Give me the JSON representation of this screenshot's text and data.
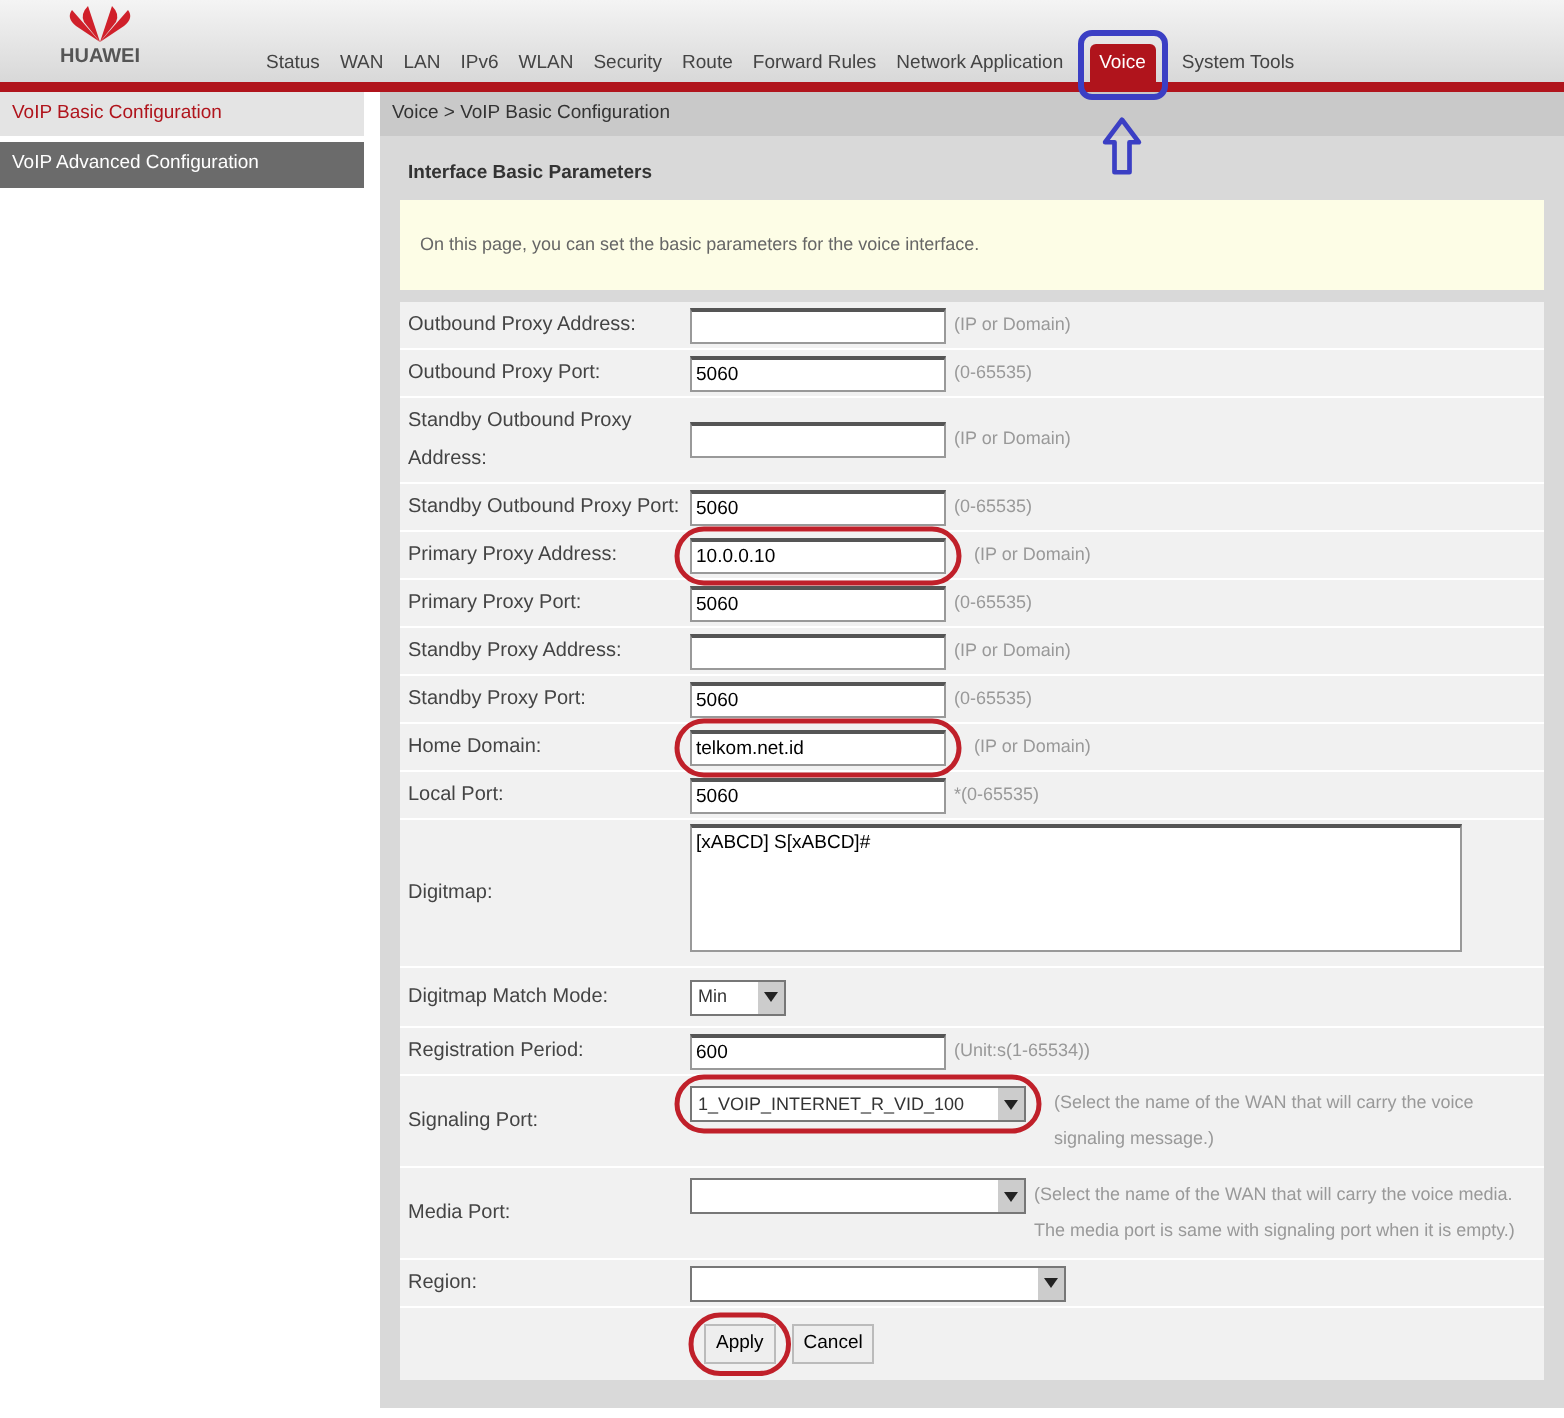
{
  "header": {
    "logo": "HUAWEI",
    "tabs": [
      {
        "label": "Status",
        "selected": false,
        "marked": false
      },
      {
        "label": "WAN",
        "selected": false,
        "marked": false
      },
      {
        "label": "LAN",
        "selected": false,
        "marked": false
      },
      {
        "label": "IPv6",
        "selected": false,
        "marked": false
      },
      {
        "label": "WLAN",
        "selected": false,
        "marked": false
      },
      {
        "label": "Security",
        "selected": false,
        "marked": false
      },
      {
        "label": "Route",
        "selected": false,
        "marked": false
      },
      {
        "label": "Forward Rules",
        "selected": false,
        "marked": false
      },
      {
        "label": "Network Application",
        "selected": false,
        "marked": false
      },
      {
        "label": "Voice",
        "selected": true,
        "marked": true
      },
      {
        "label": "System Tools",
        "selected": false,
        "marked": false
      }
    ]
  },
  "sidebar": {
    "items": [
      {
        "label": "VoIP Basic Configuration",
        "selected": true
      },
      {
        "label": "VoIP Advanced Configuration",
        "selected": false
      }
    ]
  },
  "breadcrumb": "Voice > VoIP Basic Configuration",
  "section_title": "Interface Basic Parameters",
  "info": "On this page, you can set the basic parameters for the voice interface.",
  "fields": [
    {
      "kind": "text",
      "label": "Outbound Proxy Address:",
      "hint": "(IP or Domain)",
      "circled": false
    },
    {
      "kind": "text",
      "label": "Outbound Proxy Port:",
      "value": "5060",
      "hint": "(0-65535)",
      "circled": false
    },
    {
      "kind": "text",
      "label": "Standby Outbound Proxy Address:",
      "hint": "(IP or Domain)",
      "circled": false
    },
    {
      "kind": "text",
      "label": "Standby Outbound Proxy Port:",
      "value": "5060",
      "hint": "(0-65535)",
      "circled": false
    },
    {
      "kind": "text",
      "label": "Primary Proxy Address:",
      "value": "10.0.0.10",
      "hint": "(IP or Domain)",
      "circled": true
    },
    {
      "kind": "text",
      "label": "Primary Proxy Port:",
      "value": "5060",
      "hint": "(0-65535)",
      "circled": false
    },
    {
      "kind": "text",
      "label": "Standby Proxy Address:",
      "hint": "(IP or Domain)",
      "circled": false
    },
    {
      "kind": "text",
      "label": "Standby Proxy Port:",
      "value": "5060",
      "hint": "(0-65535)",
      "circled": false
    },
    {
      "kind": "text",
      "label": "Home Domain:",
      "value": "telkom.net.id",
      "hint": "(IP or Domain)",
      "circled": true
    },
    {
      "kind": "text",
      "label": "Local Port:",
      "value": "5060",
      "hint": "*(0-65535)",
      "circled": false
    },
    {
      "kind": "textarea",
      "label": "Digitmap:",
      "value": "[xABCD] S[xABCD]#",
      "circled": false
    },
    {
      "kind": "smallselect",
      "label": "Digitmap Match Mode:",
      "value": "Min",
      "circled": false
    },
    {
      "kind": "text",
      "label": "Registration Period:",
      "value": "600",
      "hint": "(Unit:s(1-65534))",
      "circled": false
    },
    {
      "kind": "select",
      "label": "Signaling Port:",
      "value": "1_VOIP_INTERNET_R_VID_100",
      "hint": "(Select the name of the WAN that will carry the voice signaling message.)",
      "circled": true
    },
    {
      "kind": "select",
      "label": "Media Port:",
      "hint": "(Select the name of the WAN that will carry the voice media. The media port is same with signaling port when it is empty.)",
      "circled": false
    },
    {
      "kind": "wideselect",
      "label": "Region:",
      "circled": false
    }
  ],
  "buttons": [
    {
      "label": "Apply",
      "circled": true
    },
    {
      "label": "Cancel",
      "circled": false
    }
  ]
}
